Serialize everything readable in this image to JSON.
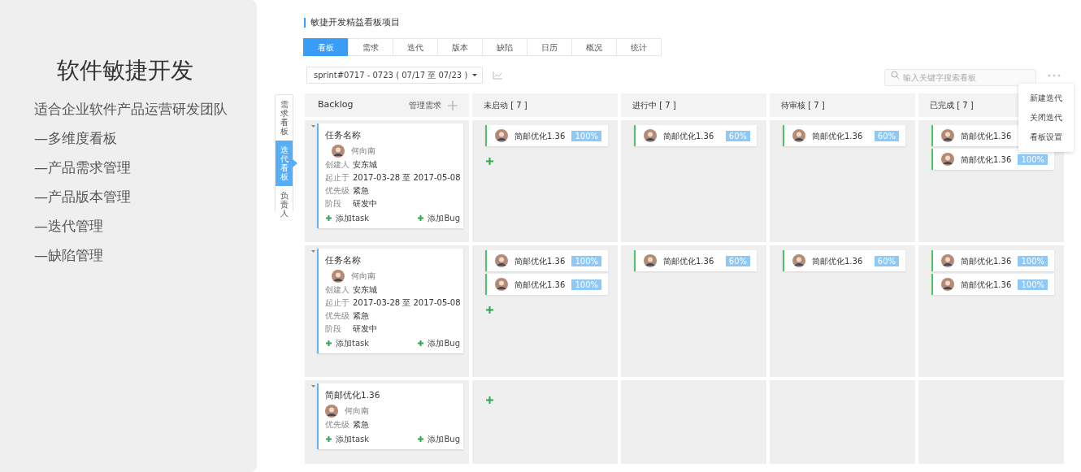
{
  "intro": {
    "title": "软件敏捷开发",
    "lines": [
      "适合企业软件产品运营研发团队",
      "—多维度看板",
      "—产品需求管理",
      "—产品版本管理",
      "—迭代管理",
      "—缺陷管理"
    ]
  },
  "project": {
    "title": "敏捷开发精益看板项目"
  },
  "tabs": [
    {
      "label": "看板",
      "selected": true
    },
    {
      "label": "需求",
      "selected": false
    },
    {
      "label": "迭代",
      "selected": false
    },
    {
      "label": "版本",
      "selected": false
    },
    {
      "label": "缺陷",
      "selected": false
    },
    {
      "label": "日历",
      "selected": false
    },
    {
      "label": "概况",
      "selected": false
    },
    {
      "label": "统计",
      "selected": false
    }
  ],
  "toolbar": {
    "sprint": "sprint#0717 - 0723 ( 07/17 至 07/23 )",
    "search_placeholder": "输入关键字搜索看板"
  },
  "menu": [
    "新建迭代",
    "关闭迭代",
    "看板设置"
  ],
  "side_tabs": [
    {
      "label": "需求看板",
      "selected": false
    },
    {
      "label": "迭代看板",
      "selected": true
    },
    {
      "label": "负责人",
      "selected": false
    }
  ],
  "board": {
    "backlog": {
      "title": "Backlog",
      "action": "管理需求"
    },
    "columns": [
      "未启动 [ 7 ]",
      "进行中 [ 7 ]",
      "待审核 [ 7 ]",
      "已完成 [ 7 ]"
    ],
    "rows": [
      {
        "backlog_card": {
          "title": "任务名称",
          "assignee": "何向南",
          "fields": [
            {
              "label": "创建人",
              "value": "安东城"
            },
            {
              "label": "起止于",
              "value": "2017-03-28 至 2017-05-08"
            },
            {
              "label": "优先级",
              "value": "紧急"
            },
            {
              "label": "阶段",
              "value": "研发中"
            }
          ],
          "actions": [
            "添加task",
            "添加Bug"
          ]
        },
        "cells": [
          {
            "add": true,
            "cards": [
              {
                "title": "简邮优化1.36",
                "progress": "100%"
              }
            ]
          },
          {
            "add": false,
            "cards": [
              {
                "title": "简邮优化1.36",
                "progress": "60%"
              }
            ]
          },
          {
            "add": false,
            "cards": [
              {
                "title": "简邮优化1.36",
                "progress": "60%"
              }
            ]
          },
          {
            "add": false,
            "cards": [
              {
                "title": "简邮优化1.36"
              },
              {
                "title": "简邮优化1.36",
                "progress": "100%"
              }
            ]
          }
        ]
      },
      {
        "backlog_card": {
          "title": "任务名称",
          "assignee": "何向南",
          "fields": [
            {
              "label": "创建人",
              "value": "安东城"
            },
            {
              "label": "起止于",
              "value": "2017-03-28 至 2017-05-08"
            },
            {
              "label": "优先级",
              "value": "紧急"
            },
            {
              "label": "阶段",
              "value": "研发中"
            }
          ],
          "actions": [
            "添加task",
            "添加Bug"
          ]
        },
        "cells": [
          {
            "add": true,
            "cards": [
              {
                "title": "简邮优化1.36",
                "progress": "100%"
              },
              {
                "title": "简邮优化1.36",
                "progress": "100%"
              }
            ]
          },
          {
            "add": false,
            "cards": [
              {
                "title": "简邮优化1.36",
                "progress": "60%"
              }
            ]
          },
          {
            "add": false,
            "cards": [
              {
                "title": "简邮优化1.36",
                "progress": "60%"
              }
            ]
          },
          {
            "add": false,
            "cards": [
              {
                "title": "简邮优化1.36",
                "progress": "100%"
              },
              {
                "title": "简邮优化1.36",
                "progress": "100%"
              }
            ]
          }
        ]
      },
      {
        "backlog_card": {
          "title": "简邮优化1.36",
          "assignee": "何向南",
          "fields": [
            {
              "label": "优先级",
              "value": "紧急"
            }
          ],
          "actions": [
            "添加task",
            "添加Bug"
          ]
        },
        "cells": [
          {
            "add": true
          },
          {
            "add": false
          },
          {
            "add": false
          },
          {
            "add": false
          }
        ]
      }
    ]
  }
}
